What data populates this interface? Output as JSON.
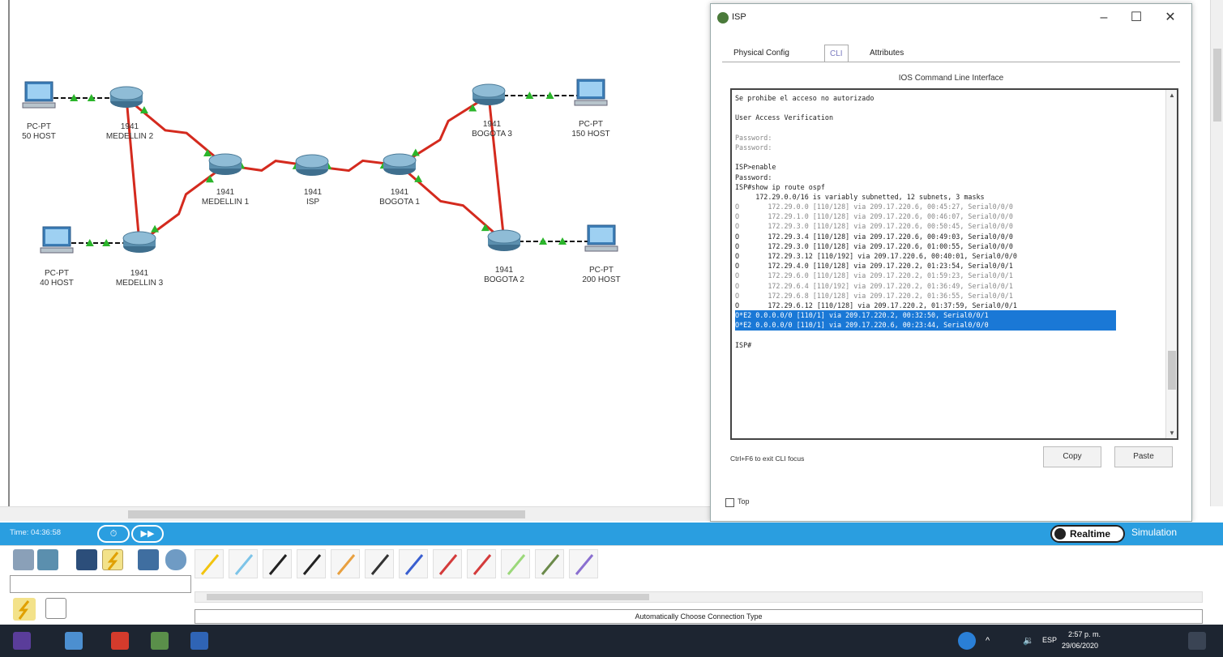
{
  "topology": {
    "nodes": [
      {
        "id": "pc50",
        "type": "pc",
        "model": "PC-PT",
        "name": "50 HOST"
      },
      {
        "id": "med2",
        "type": "router",
        "model": "1941",
        "name": "MEDELLIN 2"
      },
      {
        "id": "med1",
        "type": "router",
        "model": "1941",
        "name": "MEDELLIN 1"
      },
      {
        "id": "isp",
        "type": "router",
        "model": "1941",
        "name": "ISP"
      },
      {
        "id": "bog1",
        "type": "router",
        "model": "1941",
        "name": "BOGOTA 1"
      },
      {
        "id": "bog3",
        "type": "router",
        "model": "1941",
        "name": "BOGOTA 3"
      },
      {
        "id": "pc150",
        "type": "pc",
        "model": "PC-PT",
        "name": "150 HOST"
      },
      {
        "id": "pc40",
        "type": "pc",
        "model": "PC-PT",
        "name": "40 HOST"
      },
      {
        "id": "med3",
        "type": "router",
        "model": "1941",
        "name": "MEDELLIN 3"
      },
      {
        "id": "bog2",
        "type": "router",
        "model": "1941",
        "name": "BOGOTA 2"
      },
      {
        "id": "pc200",
        "type": "pc",
        "model": "PC-PT",
        "name": "200 HOST"
      }
    ],
    "colors": {
      "serial_link": "#d42a1e",
      "ethernet_link": "#111111",
      "link_up": "#2bb52b",
      "router": "#5b8fae",
      "pc": "#3d7fb8"
    }
  },
  "isp_window": {
    "title": "ISP",
    "tabs": [
      "Physical",
      "Config",
      "CLI",
      "Attributes"
    ],
    "active_tab": "CLI",
    "cli_header": "IOS Command Line Interface",
    "cli_lines": [
      {
        "text": "Se prohibe el acceso no autorizado",
        "style": "normal"
      },
      {
        "text": "",
        "style": "normal"
      },
      {
        "text": "User Access Verification",
        "style": "normal"
      },
      {
        "text": "",
        "style": "normal"
      },
      {
        "text": "Password:",
        "style": "faint"
      },
      {
        "text": "Password:",
        "style": "faint"
      },
      {
        "text": "",
        "style": "normal"
      },
      {
        "text": "ISP>enable",
        "style": "normal"
      },
      {
        "text": "Password:",
        "style": "normal"
      },
      {
        "text": "ISP#show ip route ospf",
        "style": "normal"
      },
      {
        "text": "     172.29.0.0/16 is variably subnetted, 12 subnets, 3 masks",
        "style": "normal"
      },
      {
        "text": "O       172.29.0.0 [110/128] via 209.17.220.6, 00:45:27, Serial0/0/0",
        "style": "faint"
      },
      {
        "text": "O       172.29.1.0 [110/128] via 209.17.220.6, 00:46:07, Serial0/0/0",
        "style": "faint"
      },
      {
        "text": "O       172.29.3.0 [110/128] via 209.17.220.6, 00:50:45, Serial0/0/0",
        "style": "faint"
      },
      {
        "text": "O       172.29.3.4 [110/128] via 209.17.220.6, 00:49:03, Serial0/0/0",
        "style": "normal"
      },
      {
        "text": "O       172.29.3.0 [110/128] via 209.17.220.6, 01:00:55, Serial0/0/0",
        "style": "normal"
      },
      {
        "text": "O       172.29.3.12 [110/192] via 209.17.220.6, 00:40:01, Serial0/0/0",
        "style": "normal"
      },
      {
        "text": "O       172.29.4.0 [110/128] via 209.17.220.2, 01:23:54, Serial0/0/1",
        "style": "normal"
      },
      {
        "text": "O       172.29.6.0 [110/128] via 209.17.220.2, 01:59:23, Serial0/0/1",
        "style": "faint"
      },
      {
        "text": "O       172.29.6.4 [110/192] via 209.17.220.2, 01:36:49, Serial0/0/1",
        "style": "faint"
      },
      {
        "text": "O       172.29.6.8 [110/128] via 209.17.220.2, 01:36:55, Serial0/0/1",
        "style": "faint"
      },
      {
        "text": "O       172.29.6.12 [110/128] via 209.17.220.2, 01:37:59, Serial0/0/1",
        "style": "normal"
      },
      {
        "text": "O*E2 0.0.0.0/0 [110/1] via 209.17.220.2, 00:32:50, Serial0/0/1",
        "style": "hl"
      },
      {
        "text": "O*E2 0.0.0.0/0 [110/1] via 209.17.220.6, 00:23:44, Serial0/0/0",
        "style": "hl"
      },
      {
        "text": "",
        "style": "normal"
      },
      {
        "text": "ISP#",
        "style": "normal"
      }
    ],
    "hint": "Ctrl+F6 to exit CLI focus",
    "copy_label": "Copy",
    "paste_label": "Paste",
    "top_label": "Top"
  },
  "statusbar": {
    "time": "Time: 04:36:58",
    "realtime_label": "Realtime",
    "simulation_label": "Simulation"
  },
  "device_panel": {
    "connection_type_label": "Automatically Choose Connection Type",
    "connection_icons": [
      "auto-connection-icon",
      "console-cable-icon",
      "copper-straight-icon",
      "copper-cross-icon",
      "fiber-icon",
      "phone-cable-icon",
      "coaxial-icon",
      "serial-dce-icon",
      "serial-dte-icon",
      "octal-cable-icon",
      "iot-custom-cable-icon",
      "usb-cable-icon"
    ]
  },
  "taskbar": {
    "language": "ESP",
    "time": "2:57 p. m.",
    "date": "29/06/2020"
  }
}
